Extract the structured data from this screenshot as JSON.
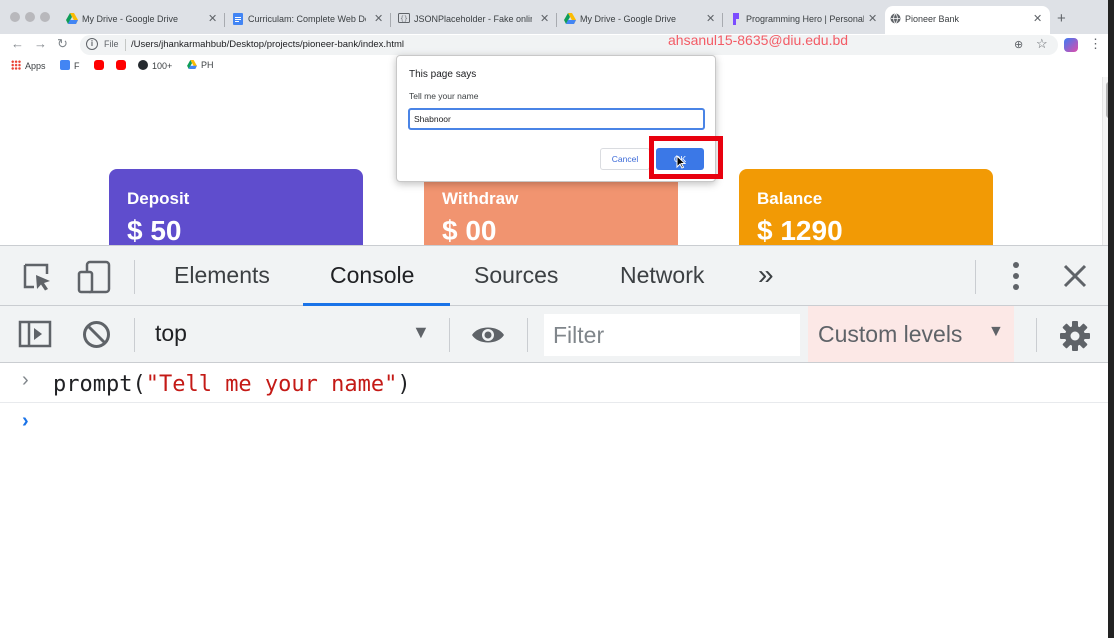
{
  "browser": {
    "tabs": [
      {
        "label": "My Drive - Google Drive",
        "icon": "google-drive-icon"
      },
      {
        "label": "Curriculam: Complete Web Dev",
        "icon": "google-docs-icon"
      },
      {
        "label": "JSONPlaceholder - Fake online",
        "icon": "json-placeholder-icon"
      },
      {
        "label": "My Drive - Google Drive",
        "icon": "google-drive-icon"
      },
      {
        "label": "Programming Hero | Personal w",
        "icon": "programming-hero-icon"
      },
      {
        "label": "Pioneer Bank",
        "icon": "globe-icon",
        "active": true
      }
    ],
    "new_tab": "+",
    "close_glyph": "✕",
    "address": {
      "scheme_label": "File",
      "url": "/Users/jhankarmahbub/Desktop/projects/pioneer-bank/index.html"
    },
    "watermark": "ahsanul15-8635@diu.edu.bd",
    "bookmarks": [
      {
        "label": "Apps",
        "icon": "apps-grid-icon"
      },
      {
        "label": "F",
        "icon": "google-docs-icon"
      },
      {
        "label": "",
        "icon": "youtube-icon"
      },
      {
        "label": "",
        "icon": "youtube-icon"
      },
      {
        "label": "100+",
        "icon": "github-icon"
      },
      {
        "label": "PH",
        "icon": "google-drive-icon"
      }
    ]
  },
  "page": {
    "cards": [
      {
        "title": "Deposit",
        "amount": "$ 50",
        "color": "#5f4dcd"
      },
      {
        "title": "Withdraw",
        "amount": "$ 00",
        "color": "#f19470"
      },
      {
        "title": "Balance",
        "amount": "$ 1290",
        "color": "#f29a05"
      }
    ]
  },
  "dialog": {
    "title": "This page says",
    "message": "Tell me your name",
    "input_value": "Shabnoor",
    "cancel_label": "Cancel",
    "ok_label": "OK"
  },
  "devtools": {
    "tabs": [
      "Elements",
      "Console",
      "Sources",
      "Network"
    ],
    "more_tabs": "»",
    "active_tab": "Console",
    "context": "top",
    "filter_placeholder": "Filter",
    "levels_label": "Custom levels",
    "console": {
      "input_prefix": "prompt(",
      "input_string": "\"Tell me your name\"",
      "input_suffix": ")",
      "chevron": "›"
    }
  },
  "colors": {
    "accent": "#1a73e8",
    "highlight_box": "#e8000e",
    "ok_button": "#3b78e7"
  }
}
